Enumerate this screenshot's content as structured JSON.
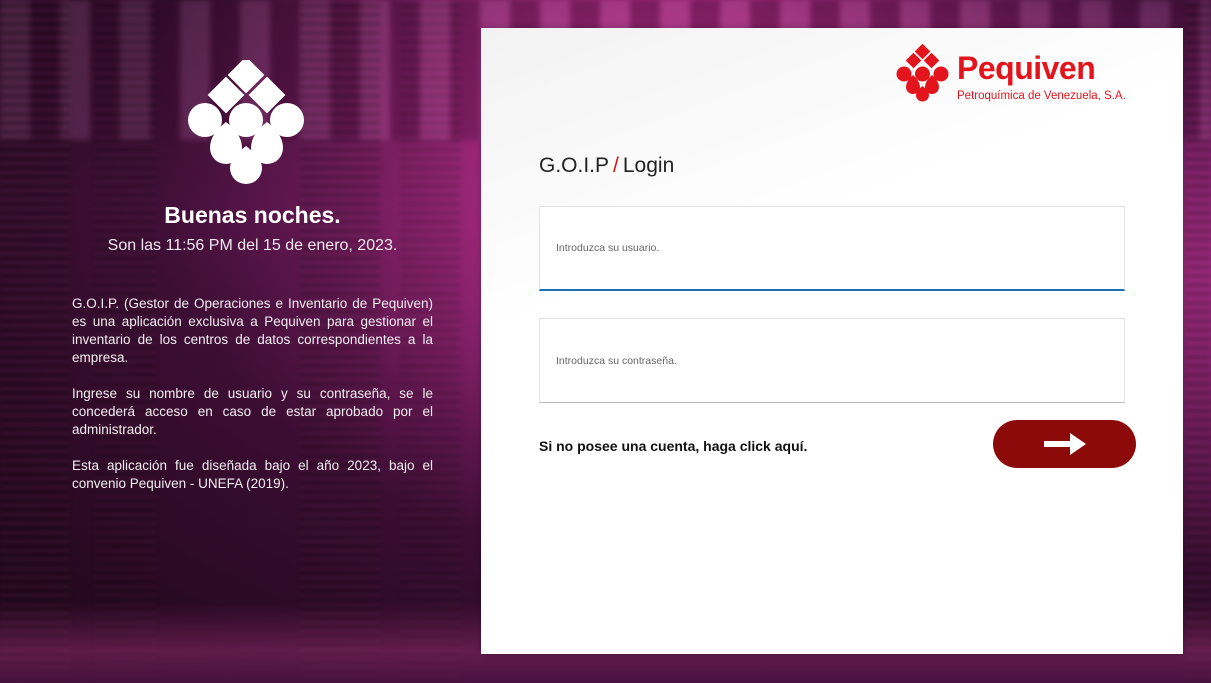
{
  "left_panel": {
    "greeting": "Buenas noches.",
    "datetime": "Son las 11:56 PM del 15 de enero, 2023.",
    "description_1": "G.O.I.P. (Gestor de Operaciones e Inventario de Pequiven) es una aplicación exclusiva a Pequiven para gestionar el inventario de los centros de datos correspondientes a la empresa.",
    "description_2": "Ingrese su nombre de usuario y su contraseña, se le concederá acceso en caso de estar aprobado por el administrador.",
    "description_3": "Esta aplicación fue diseñada bajo el año 2023, bajo el convenio Pequiven - UNEFA (2019)."
  },
  "logo": {
    "name": "Pequiven",
    "subtitle": "Petroquímica de Venezuela, S.A.",
    "icon": "pequiven-diamond-icon"
  },
  "login": {
    "title_app": "G.O.I.P",
    "title_separator": "/",
    "title_page": "Login",
    "username_placeholder": "Introduzca su usuario.",
    "username_value": "",
    "password_placeholder": "Introduzca su contraseña.",
    "password_value": "",
    "signup_link": "Si no posee una cuenta, haga click aquí.",
    "submit_icon": "arrow-right-icon"
  },
  "colors": {
    "brand_red": "#e3141b",
    "submit_bg": "#8d0a0a",
    "focus_border": "#1b6fb5"
  }
}
